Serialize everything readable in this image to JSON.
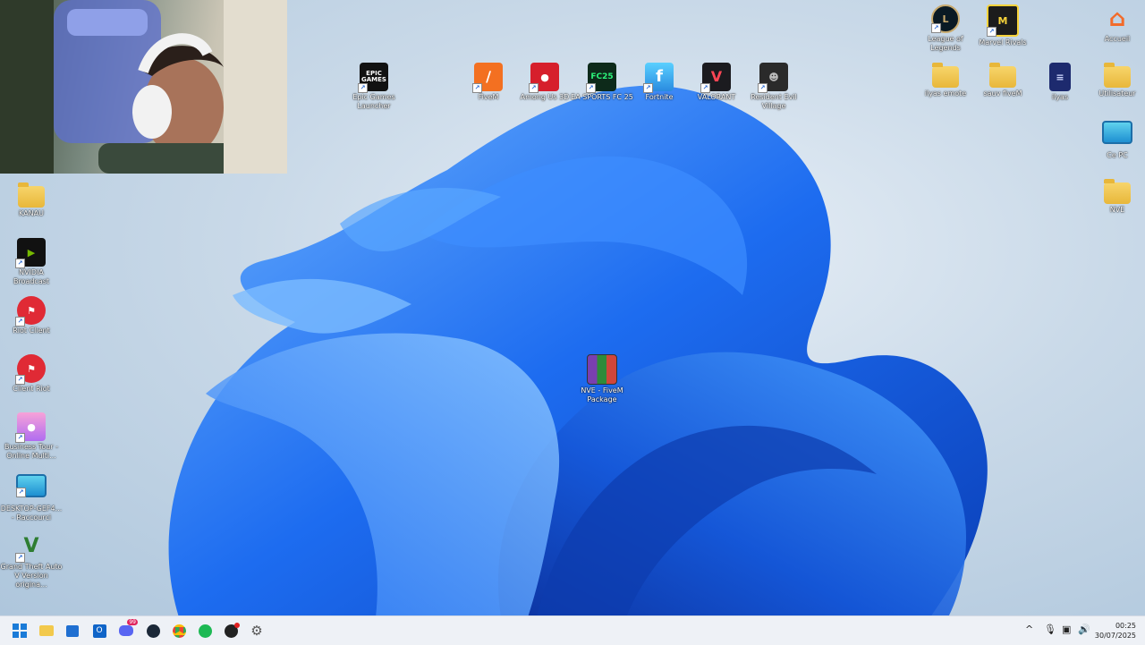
{
  "desktop": {
    "icons_left": [
      {
        "id": "kanau",
        "label": "KANAU",
        "icon": "folder-icon"
      },
      {
        "id": "nvidia-broadcast",
        "label": "NVIDIA Broadcast",
        "icon": "nvidia-icon"
      },
      {
        "id": "riot-client",
        "label": "Riot Client",
        "icon": "riot-icon"
      },
      {
        "id": "client-riot",
        "label": "Client Riot",
        "icon": "riot-icon"
      },
      {
        "id": "business-tour",
        "label": "Business Tour - Online Multi...",
        "icon": "business-tour-icon"
      },
      {
        "id": "desktop-raccourci",
        "label": "DESKTOP-GEF4... - Raccourci",
        "icon": "computer-icon"
      },
      {
        "id": "gta-v",
        "label": "Grand Theft Auto V Version origina...",
        "icon": "gta-icon"
      }
    ],
    "icons_top": [
      {
        "id": "epic",
        "label": "Epic Games Launcher",
        "icon": "epic-games-icon",
        "badge": "EPIC GAMES"
      },
      {
        "id": "fivem",
        "label": "FiveM",
        "icon": "fivem-icon"
      },
      {
        "id": "among-us",
        "label": "Among Us 3D",
        "icon": "among-us-icon"
      },
      {
        "id": "eafc",
        "label": "EA SPORTS FC 25",
        "icon": "ea-fc-icon",
        "badge": "FC25"
      },
      {
        "id": "fortnite",
        "label": "Fortnite",
        "icon": "fortnite-icon",
        "badge": "f"
      },
      {
        "id": "valorant",
        "label": "VALORANT",
        "icon": "valorant-icon"
      },
      {
        "id": "re-village",
        "label": "Resident Evil Village",
        "icon": "resident-evil-icon"
      }
    ],
    "icons_right": [
      {
        "id": "lol",
        "label": "League of Legends",
        "icon": "league-icon"
      },
      {
        "id": "marvel",
        "label": "Marvel Rivals",
        "icon": "marvel-rivals-icon"
      },
      {
        "id": "accueil",
        "label": "Accueil",
        "icon": "home-icon"
      },
      {
        "id": "ilyas-emote",
        "label": "ilyas emote",
        "icon": "folder-icon"
      },
      {
        "id": "sauv-fivem",
        "label": "sauv fiveM",
        "icon": "folder-icon"
      },
      {
        "id": "ilyas",
        "label": "ilyas",
        "icon": "document-icon"
      },
      {
        "id": "utilisateur",
        "label": "Utilisateur",
        "icon": "folder-icon"
      },
      {
        "id": "ce-pc",
        "label": "Ce PC",
        "icon": "computer-icon"
      },
      {
        "id": "nve",
        "label": "NVE",
        "icon": "folder-icon"
      }
    ],
    "center_icon": {
      "id": "nve-package",
      "label": "NVE - FiveM Package",
      "icon": "winrar-archive-icon"
    }
  },
  "taskbar": {
    "apps": [
      {
        "name": "start-button",
        "icon": "windows-icon"
      },
      {
        "name": "file-explorer-button",
        "icon": "folder-icon"
      },
      {
        "name": "store-button",
        "icon": "store-icon"
      },
      {
        "name": "outlook-button",
        "icon": "outlook-icon"
      },
      {
        "name": "discord-button",
        "icon": "discord-icon",
        "badge": "99"
      },
      {
        "name": "steam-button",
        "icon": "steam-icon"
      },
      {
        "name": "chrome-button",
        "icon": "chrome-icon"
      },
      {
        "name": "spotify-button",
        "icon": "spotify-icon"
      },
      {
        "name": "obs-button",
        "icon": "obs-icon"
      },
      {
        "name": "settings-button",
        "icon": "gear-icon"
      }
    ],
    "tray": {
      "chevron": "^",
      "clock_time": "00:25",
      "clock_date": "30/07/2025"
    }
  },
  "colors": {
    "taskbar_bg": "#eef1f6",
    "wallpaper_blue": "#1a5fe0",
    "folder": "#f2c94c"
  }
}
